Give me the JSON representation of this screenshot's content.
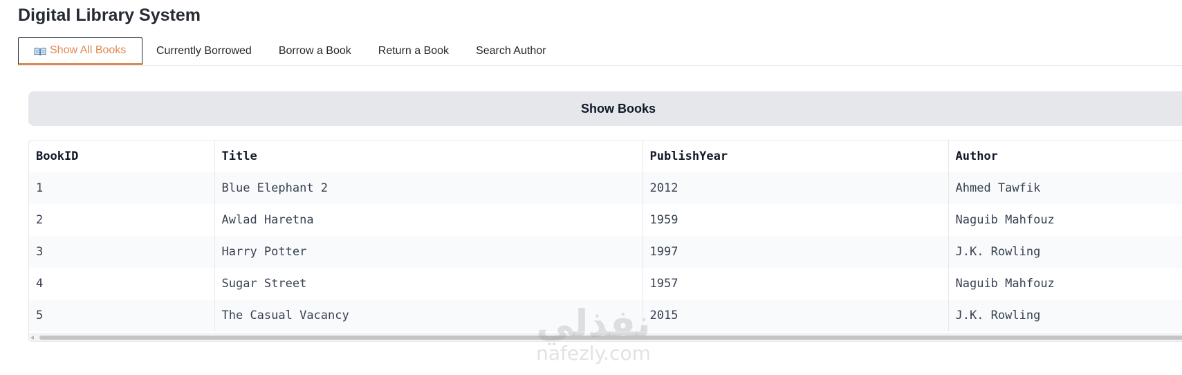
{
  "app": {
    "title": "Digital Library System"
  },
  "tabs": [
    {
      "label": "Show All Books",
      "icon": "open-book-icon",
      "active": true
    },
    {
      "label": "Currently Borrowed",
      "active": false
    },
    {
      "label": "Borrow a Book",
      "active": false
    },
    {
      "label": "Return a Book",
      "active": false
    },
    {
      "label": "Search Author",
      "active": false
    }
  ],
  "main": {
    "show_books_button": "Show Books",
    "table": {
      "columns": [
        "BookID",
        "Title",
        "PublishYear",
        "Author"
      ],
      "rows": [
        [
          "1",
          "Blue Elephant 2",
          "2012",
          "Ahmed Tawfik"
        ],
        [
          "2",
          "Awlad Haretna",
          "1959",
          "Naguib Mahfouz"
        ],
        [
          "3",
          "Harry Potter",
          "1997",
          "J.K. Rowling"
        ],
        [
          "4",
          "Sugar Street",
          "1957",
          "Naguib Mahfouz"
        ],
        [
          "5",
          "The Casual Vacancy",
          "2015",
          "J.K. Rowling"
        ]
      ]
    }
  },
  "watermark": {
    "arabic": "نفذلي",
    "latin": "nafezly.com"
  },
  "colors": {
    "accent": "#e0884f",
    "button_bg": "#e5e7eb",
    "row_stripe": "#f9fafb"
  }
}
